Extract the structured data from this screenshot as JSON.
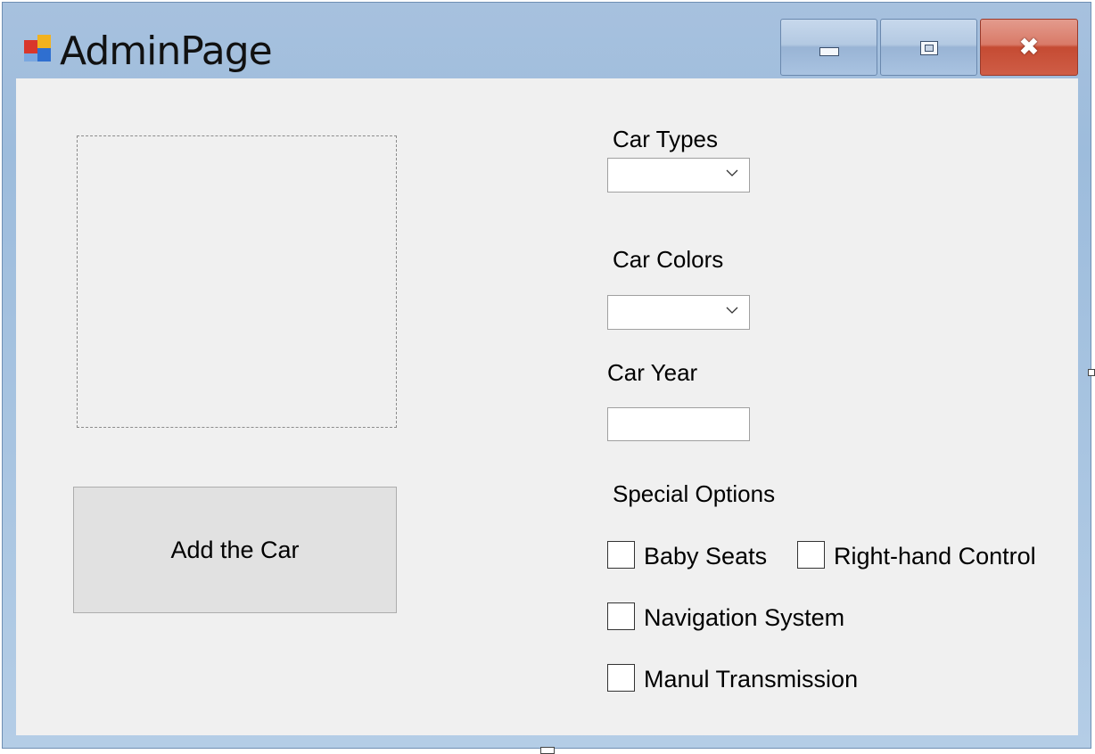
{
  "window": {
    "title": "AdminPage",
    "controls": {
      "minimize": "minimize",
      "maximize": "maximize",
      "close": "close"
    }
  },
  "left_panel": {
    "add_button_label": "Add the Car"
  },
  "form": {
    "car_types": {
      "label": "Car Types",
      "value": ""
    },
    "car_colors": {
      "label": "Car Colors",
      "value": ""
    },
    "car_year": {
      "label": "Car Year",
      "value": ""
    },
    "special_options": {
      "label": "Special Options",
      "options": [
        {
          "label": "Baby Seats",
          "checked": false
        },
        {
          "label": "Right-hand Control",
          "checked": false
        },
        {
          "label": "Navigation System",
          "checked": false
        },
        {
          "label": "Manul Transmission",
          "checked": false
        }
      ]
    }
  },
  "icons": {
    "app": "form-icon",
    "dropdown": "chevron-down-icon",
    "close": "close-icon"
  },
  "colors": {
    "title_bar": "#9dbcdc",
    "client_bg": "#f0f0f0",
    "close_button": "#c54b33",
    "button_bg": "#e1e1e1"
  }
}
